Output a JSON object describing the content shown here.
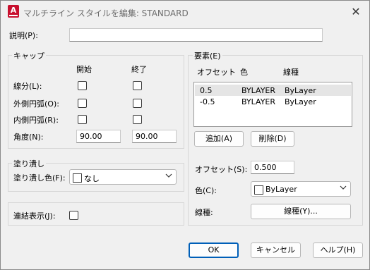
{
  "window": {
    "title": "マルチライン スタイルを編集: STANDARD",
    "close_glyph": "✕",
    "app_icon_letter": "A"
  },
  "description": {
    "label": "説明(P):",
    "value": ""
  },
  "caps": {
    "group_label": "キャップ",
    "col_start": "開始",
    "col_end": "終了",
    "line_label": "線分(L):",
    "outer_arc_label": "外側円弧(O):",
    "inner_arc_label": "内側円弧(R):",
    "angle_label": "角度(N):",
    "angle_start": "90.00",
    "angle_end": "90.00"
  },
  "fill": {
    "group_label": "塗り潰し",
    "color_label": "塗り潰し色(F):",
    "color_value": "なし"
  },
  "joints": {
    "label": "連結表示(J):"
  },
  "elements": {
    "group_label": "要素(E)",
    "col_offset": "オフセット",
    "col_color": "色",
    "col_linetype": "線種",
    "rows": [
      {
        "offset": "0.5",
        "color": "BYLAYER",
        "linetype": "ByLayer"
      },
      {
        "offset": "-0.5",
        "color": "BYLAYER",
        "linetype": "ByLayer"
      }
    ],
    "add_button": "追加(A)",
    "delete_button": "削除(D)",
    "offset_label": "オフセット(S):",
    "offset_value": "0.500",
    "color_label": "色(C):",
    "color_value": "ByLayer",
    "linetype_label": "線種:",
    "linetype_button": "線種(Y)..."
  },
  "footer": {
    "ok": "OK",
    "cancel": "キャンセル",
    "help": "ヘルプ(H)"
  },
  "colors": {
    "accent": "#005fb8",
    "autocad_red": "#c8102e"
  }
}
